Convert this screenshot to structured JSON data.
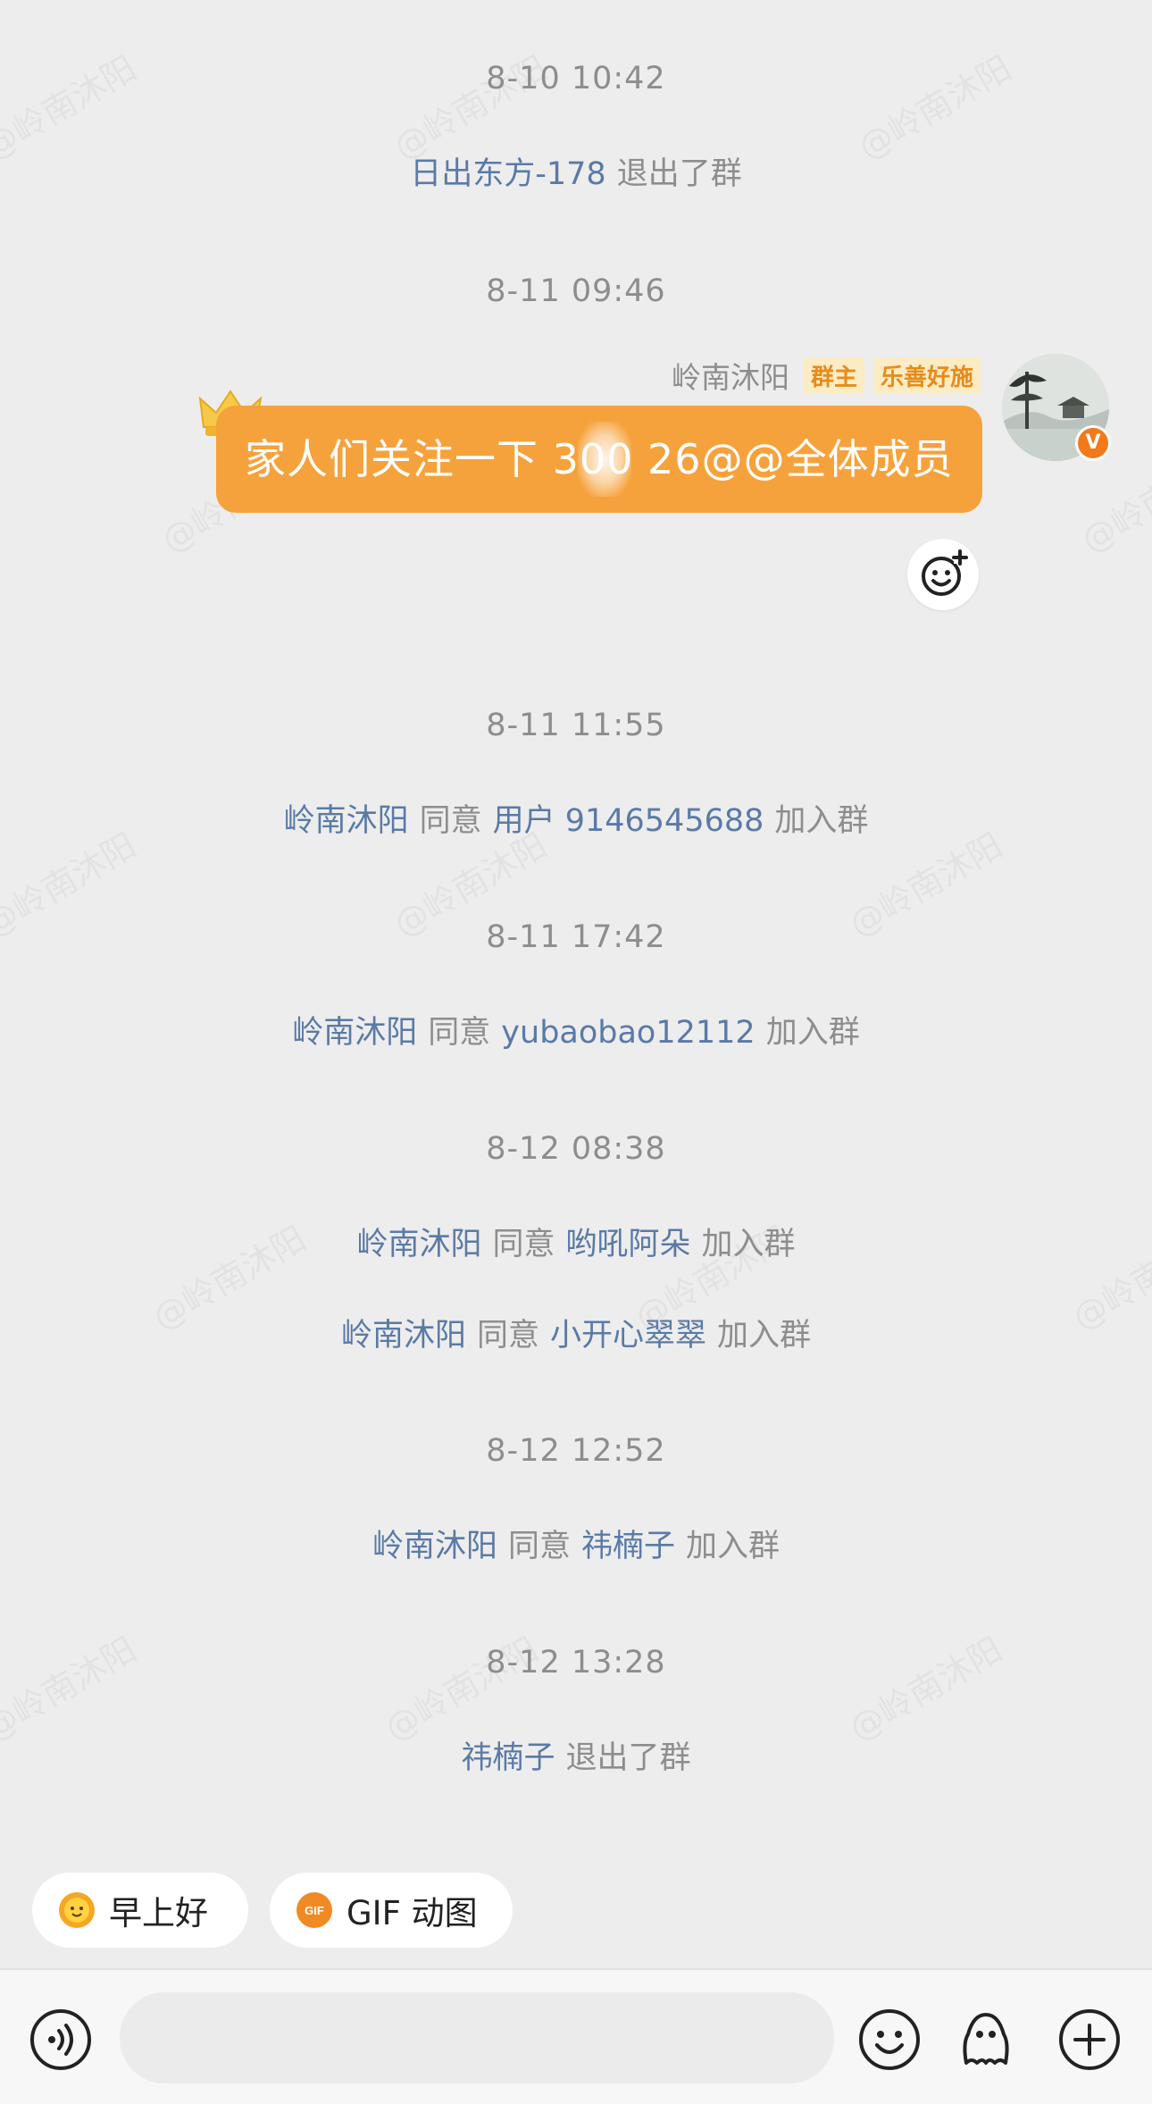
{
  "watermark_text": "@岭南沐阳",
  "timestamps": [
    "8-10 10:42",
    "8-11 09:46",
    "8-11 11:55",
    "8-11 17:42",
    "8-12 08:38",
    "8-12 12:52",
    "8-12 13:28"
  ],
  "system_messages": [
    {
      "user": "日出东方-178",
      "action": "退出了群"
    },
    {
      "admin": "岭南沐阳",
      "verb": "同意",
      "user": "用户 9146545688",
      "action": "加入群"
    },
    {
      "admin": "岭南沐阳",
      "verb": "同意",
      "user": "yubaobao12112",
      "action": "加入群"
    },
    {
      "admin": "岭南沐阳",
      "verb": "同意",
      "user": "哟吼阿朵",
      "action": "加入群"
    },
    {
      "admin": "岭南沐阳",
      "verb": "同意",
      "user": "小开心翠翠",
      "action": "加入群"
    },
    {
      "admin": "岭南沐阳",
      "verb": "同意",
      "user": "祎楠子",
      "action": "加入群"
    },
    {
      "user": "祎楠子",
      "action": "退出了群"
    }
  ],
  "message": {
    "sender": "岭南沐阳",
    "badges": [
      "群主",
      "乐善好施"
    ],
    "text": "家人们关注一下 300 26@@全体成员",
    "bubble_color": "#f6a23c"
  },
  "quick_replies": [
    {
      "label": "早上好",
      "icon": "sun-emoji-icon"
    },
    {
      "label": "GIF 动图",
      "icon": "gif-icon"
    }
  ],
  "colors": {
    "link": "#5a7aa6",
    "muted": "#8d8d8d",
    "accent": "#f27a1a",
    "background": "#ededed"
  }
}
